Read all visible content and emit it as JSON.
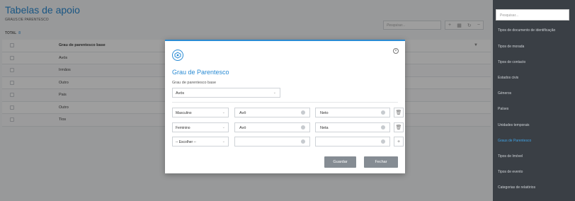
{
  "page": {
    "title": "Tabelas de apoio",
    "breadcrumb": "GRAUS DE PARENTESCO",
    "total_label": "TOTAL",
    "total_count": "8",
    "search_placeholder": "Pesquisar...",
    "table": {
      "header": "Grau de parentesco base",
      "rows": [
        "Avós",
        "Irmãos",
        "Outro",
        "Pais",
        "Outro",
        "Tios"
      ]
    }
  },
  "sidebar": {
    "search_placeholder": "Pesquisar...",
    "items": [
      "Tipos de documento de identificação",
      "Tipos de morada",
      "Tipos de contacto",
      "Estados civis",
      "Géneros",
      "Países",
      "Unidades temporais",
      "Graus de Parentesco",
      "Tipos de Imóvel",
      "Tipos de evento",
      "Categorias de relatórios"
    ],
    "active_index": 7
  },
  "modal": {
    "title": "Grau de Parentesco",
    "base_label": "Grau de parentesco base",
    "base_value": "Avós",
    "rows": [
      {
        "gender": "Masculino",
        "term1": "Avô",
        "term2": "Neto",
        "action": "delete"
      },
      {
        "gender": "Feminino",
        "term1": "Avó",
        "term2": "Neta",
        "action": "delete"
      },
      {
        "gender": "-- Escolher --",
        "term1": "",
        "term2": "",
        "action": "add"
      }
    ],
    "save_label": "Guardar",
    "close_label": "Fechar"
  },
  "colors": {
    "accent": "#2a8bd4",
    "sidebar_bg": "#3a3f45",
    "button_bg": "#858c93"
  }
}
